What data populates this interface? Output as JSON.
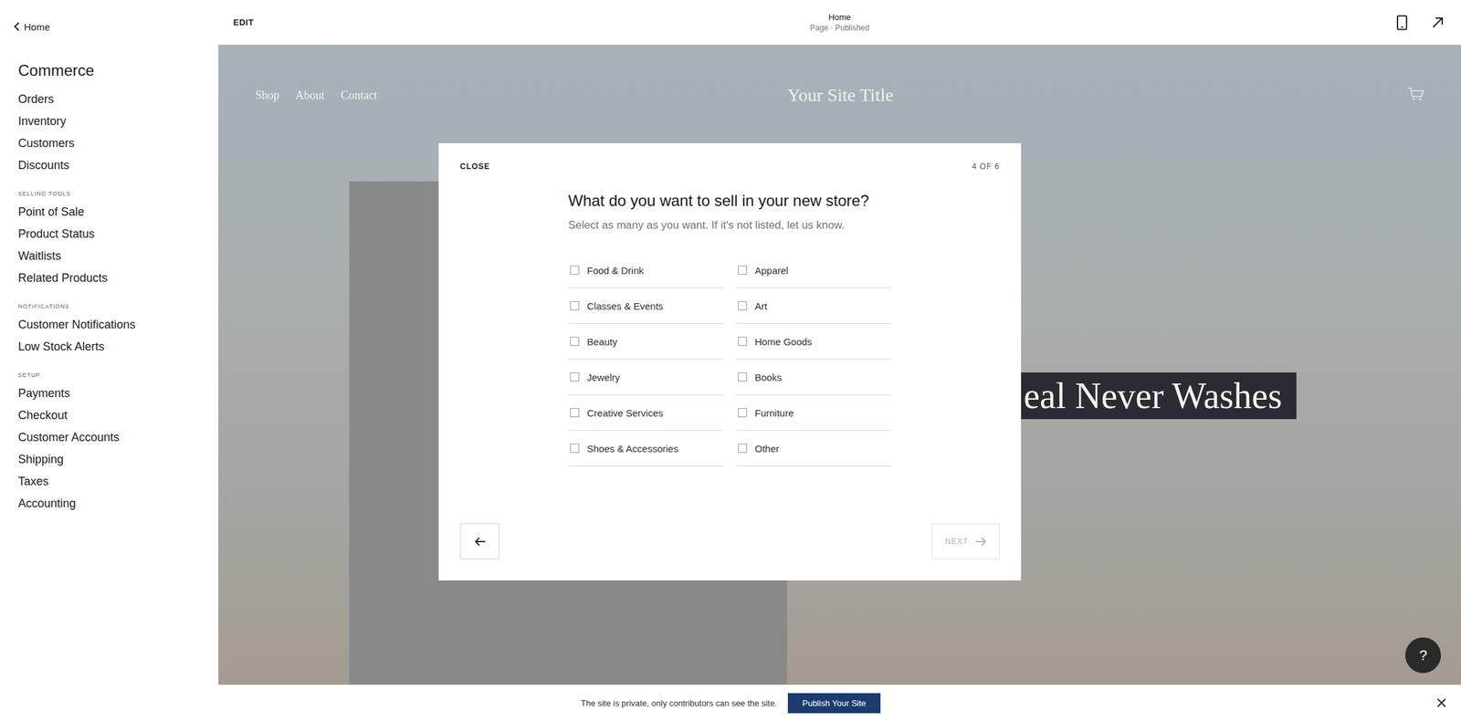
{
  "topbar": {
    "back": "Home",
    "edit": "EDIT",
    "page_title": "Home",
    "page_status": "Page · Published"
  },
  "sidebar": {
    "title": "Commerce",
    "items": [
      {
        "label": "Orders"
      },
      {
        "label": "Inventory"
      },
      {
        "label": "Customers"
      },
      {
        "label": "Discounts"
      }
    ],
    "sections": [
      {
        "heading": "SELLING TOOLS",
        "items": [
          {
            "label": "Point of Sale"
          },
          {
            "label": "Product Status"
          },
          {
            "label": "Waitlists"
          },
          {
            "label": "Related Products"
          }
        ]
      },
      {
        "heading": "NOTIFICATIONS",
        "items": [
          {
            "label": "Customer Notifications"
          },
          {
            "label": "Low Stock Alerts"
          }
        ]
      },
      {
        "heading": "SETUP",
        "items": [
          {
            "label": "Payments"
          },
          {
            "label": "Checkout"
          },
          {
            "label": "Customer Accounts"
          },
          {
            "label": "Shipping"
          },
          {
            "label": "Taxes"
          },
          {
            "label": "Accounting"
          }
        ]
      }
    ]
  },
  "site": {
    "nav": [
      "Shop",
      "About",
      "Contact"
    ],
    "title": "Your Site Title",
    "hero_text": "eal Never Washes"
  },
  "modal": {
    "close": "CLOSE",
    "step": "4 OF 6",
    "title": "What do you want to sell in your new store?",
    "subtitle": "Select as many as you want. If it's not listed, let us know.",
    "options": [
      {
        "label": "Food & Drink",
        "checked": false
      },
      {
        "label": "Apparel",
        "checked": false
      },
      {
        "label": "Classes & Events",
        "checked": false
      },
      {
        "label": "Art",
        "checked": false
      },
      {
        "label": "Beauty",
        "checked": false
      },
      {
        "label": "Home Goods",
        "checked": false
      },
      {
        "label": "Jewelry",
        "checked": false
      },
      {
        "label": "Books",
        "checked": false
      },
      {
        "label": "Creative Services",
        "checked": false
      },
      {
        "label": "Furniture",
        "checked": false
      },
      {
        "label": "Shoes & Accessories",
        "checked": false
      },
      {
        "label": "Other",
        "checked": false
      }
    ],
    "next": "NEXT",
    "next_disabled": true
  },
  "help": "?",
  "bottombar": {
    "message": "The site is private, only contributors can see the site.",
    "publish": "Publish Your Site"
  }
}
